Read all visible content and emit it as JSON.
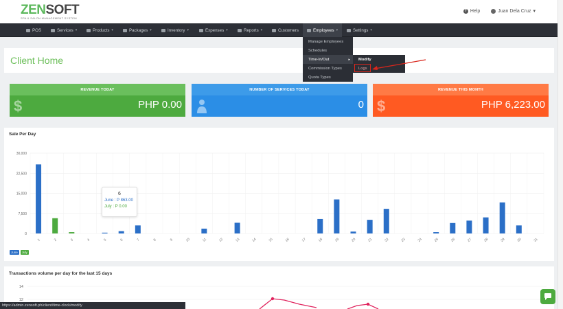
{
  "header": {
    "logo_text_a": "ZEN",
    "logo_text_b": "SOFT",
    "logo_tagline": "SPA & SALON MANAGEMENT SYSTEM",
    "help_label": "Help",
    "user_name": "Juan Dela Cruz"
  },
  "nav": {
    "items": [
      {
        "label": "POS"
      },
      {
        "label": "Services"
      },
      {
        "label": "Products"
      },
      {
        "label": "Packages"
      },
      {
        "label": "Inventory"
      },
      {
        "label": "Expenses"
      },
      {
        "label": "Reports"
      },
      {
        "label": "Customers"
      },
      {
        "label": "Employees"
      },
      {
        "label": "Settings"
      }
    ]
  },
  "dropdown": {
    "items": [
      {
        "label": "Manage Employees"
      },
      {
        "label": "Schedules"
      },
      {
        "label": "Time-In/Out"
      },
      {
        "label": "Commission Types"
      },
      {
        "label": "Quota Types"
      }
    ],
    "submenu": [
      {
        "label": "Modify"
      },
      {
        "label": "Logs"
      }
    ]
  },
  "page": {
    "title": "Client Home"
  },
  "stats": [
    {
      "label": "REVENUE TODAY",
      "value": "PHP 0.00"
    },
    {
      "label": "NUMBER OF SERVICES TODAY",
      "value": "0"
    },
    {
      "label": "REVENUE THIS MONTH",
      "value": "PHP 6,223.00"
    }
  ],
  "colors": {
    "green": "#4daa3f",
    "blue": "#2b8ee6",
    "orange": "#ff5a22",
    "nav": "#2d3037",
    "june": "#2b6fc7",
    "july": "#4daa3f"
  },
  "chart_data": {
    "type": "bar",
    "title": "Sale Per Day",
    "categories": [
      "1",
      "2",
      "3",
      "4",
      "5",
      "6",
      "7",
      "8",
      "9",
      "10",
      "11",
      "12",
      "13",
      "14",
      "15",
      "16",
      "17",
      "18",
      "19",
      "20",
      "21",
      "22",
      "23",
      "24",
      "25",
      "26",
      "27",
      "28",
      "29",
      "30",
      "31"
    ],
    "series": [
      {
        "name": "June",
        "values": [
          25800,
          0,
          0,
          0,
          300,
          863,
          3000,
          0,
          0,
          0,
          1800,
          0,
          4000,
          0,
          0,
          0,
          0,
          5400,
          12700,
          700,
          5100,
          9200,
          0,
          0,
          500,
          3900,
          4800,
          6000,
          11600,
          3000,
          0
        ]
      },
      {
        "name": "July",
        "values": [
          0,
          5700,
          500,
          0,
          0,
          0,
          0,
          0,
          0,
          0,
          0,
          0,
          0,
          0,
          0,
          0,
          0,
          0,
          0,
          0,
          0,
          0,
          0,
          0,
          0,
          0,
          0,
          0,
          0,
          0,
          0
        ]
      }
    ],
    "yticks": [
      "30,000",
      "22,500",
      "15,000",
      "7,500",
      "0"
    ],
    "ylim": [
      0,
      30000
    ],
    "grid": true,
    "legend": "bottom-left",
    "tooltip": {
      "title": "6",
      "june": "June : P 863.00",
      "july": "July : P 0.00"
    }
  },
  "transactions": {
    "title": "Transactions volume per day for the last 15 days",
    "yticks": [
      "14",
      "12"
    ]
  },
  "statusbar": {
    "url": "https://admin.zensoft.ph/client/time-clock/modify"
  }
}
